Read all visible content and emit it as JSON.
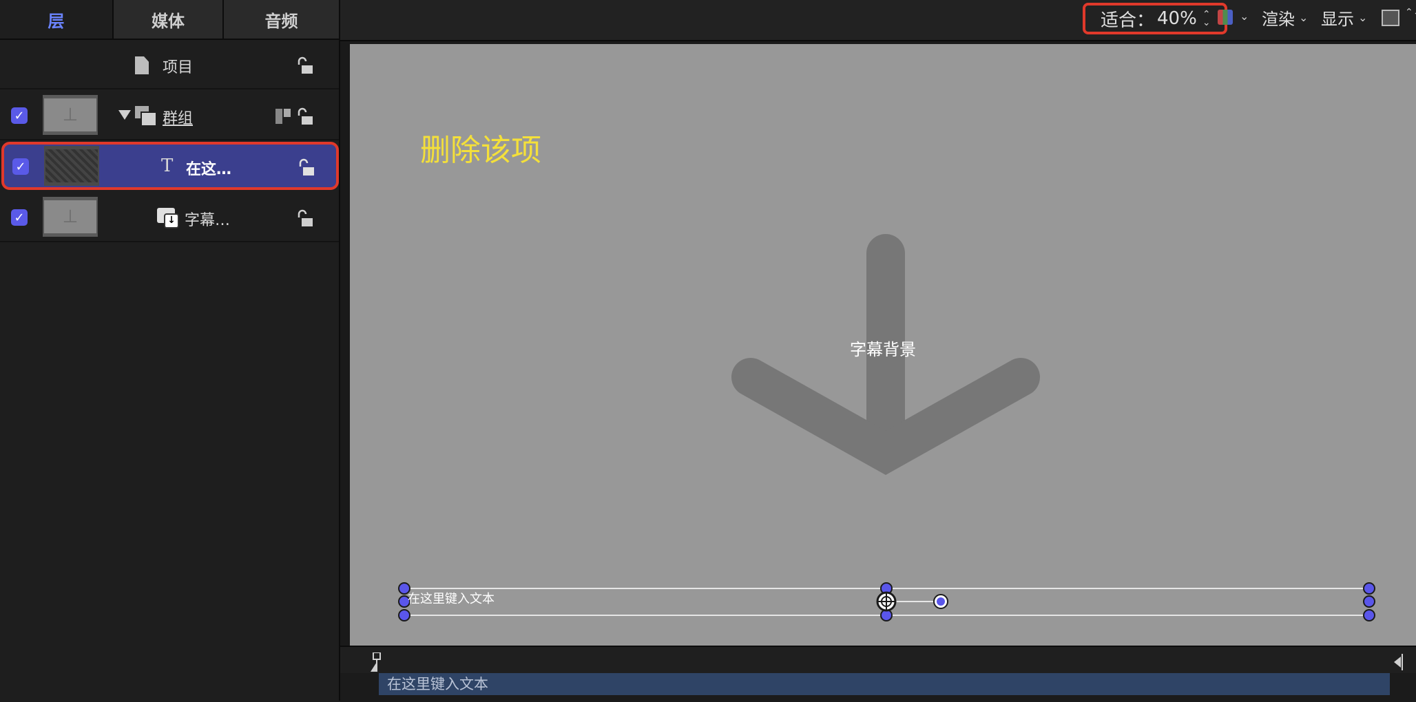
{
  "tabs": [
    "层",
    "媒体",
    "音频"
  ],
  "layers": {
    "project_label": "项目",
    "group_label": "群组",
    "text_layer_label": "在这…",
    "caption_layer_label": "字幕…"
  },
  "toolbar": {
    "fit_label": "适合：",
    "zoom_value": "40%",
    "render_label": "渲染",
    "show_label": "显示"
  },
  "canvas": {
    "title_text": "删除该项",
    "center_label": "字幕背景",
    "lower_text": "在这里键入文本"
  },
  "timeline": {
    "bar_text": "在这里键入文本"
  }
}
